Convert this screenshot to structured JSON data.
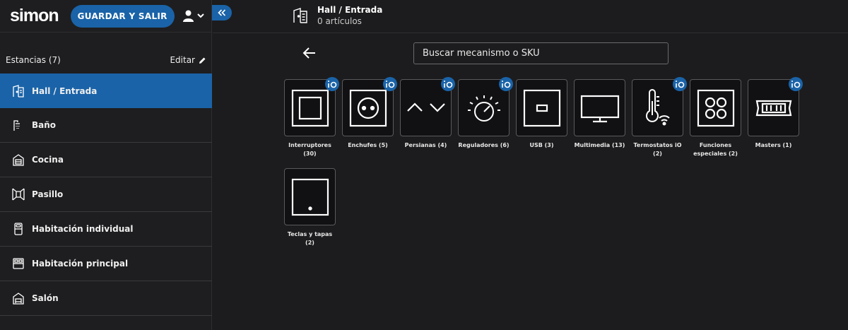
{
  "header": {
    "logo": "simon",
    "save_label": "GUARDAR Y SALIR"
  },
  "room_header": {
    "title": "Hall / Entrada",
    "subtitle": "0 artículos"
  },
  "sidebar": {
    "rooms_title": "Estancias (7)",
    "edit_label": "Editar",
    "rooms": [
      {
        "label": "Hall / Entrada",
        "icon": "hall-icon",
        "active": true
      },
      {
        "label": "Baño",
        "icon": "shower-icon",
        "active": false
      },
      {
        "label": "Cocina",
        "icon": "kitchen-icon",
        "active": false
      },
      {
        "label": "Pasillo",
        "icon": "corridor-icon",
        "active": false
      },
      {
        "label": "Habitación individual",
        "icon": "single-bed-icon",
        "active": false
      },
      {
        "label": "Habitación principal",
        "icon": "double-bed-icon",
        "active": false
      },
      {
        "label": "Salón",
        "icon": "living-room-icon",
        "active": false
      }
    ]
  },
  "search": {
    "placeholder": "Buscar mecanismo o SKU"
  },
  "categories": [
    {
      "label": "Interruptores (30)",
      "icon": "switch-icon",
      "io_badge": true
    },
    {
      "label": "Enchufes (5)",
      "icon": "socket-icon",
      "io_badge": true
    },
    {
      "label": "Persianas (4)",
      "icon": "blinds-icon",
      "io_badge": true
    },
    {
      "label": "Reguladores (6)",
      "icon": "dimmer-icon",
      "io_badge": true
    },
    {
      "label": "USB (3)",
      "icon": "usb-icon",
      "io_badge": false
    },
    {
      "label": "Multimedia (13)",
      "icon": "tv-icon",
      "io_badge": false
    },
    {
      "label": "Termostatos iO (2)",
      "icon": "thermostat-icon",
      "io_badge": true
    },
    {
      "label": "Funciones especiales (2)",
      "icon": "special-functions-icon",
      "io_badge": false
    },
    {
      "label": "Masters (1)",
      "icon": "masters-icon",
      "io_badge": true
    },
    {
      "label": "Teclas y tapas (2)",
      "icon": "key-cover-icon",
      "io_badge": false
    }
  ],
  "colors": {
    "accent": "#1a63a8",
    "background": "#1c1c1e"
  }
}
